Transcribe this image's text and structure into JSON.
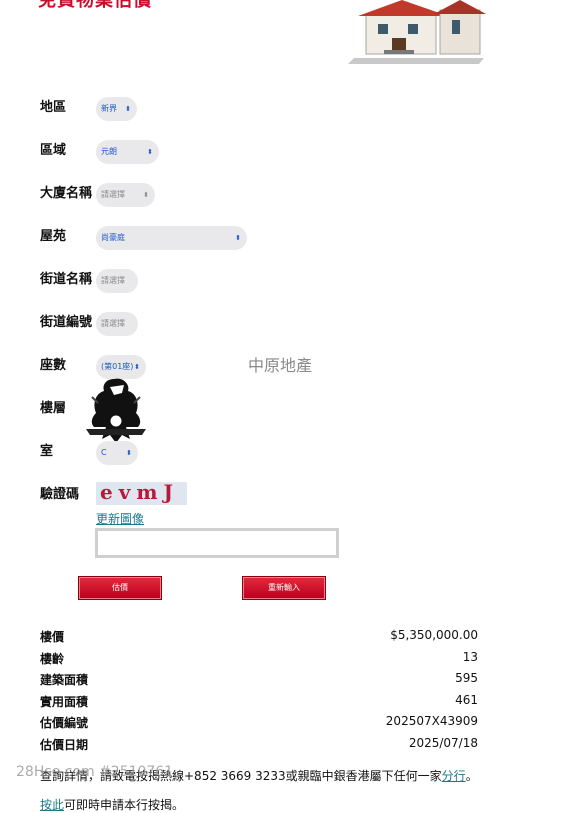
{
  "page": {
    "title": "免費物業估價"
  },
  "form": {
    "district": {
      "label": "地區",
      "value": "新界"
    },
    "area": {
      "label": "區域",
      "value": "元朗"
    },
    "building": {
      "label": "大廈名稱",
      "value": "請選擇"
    },
    "estate": {
      "label": "屋苑",
      "value": "尚豪庭"
    },
    "street_name": {
      "label": "街道名稱",
      "value": "請選擇"
    },
    "street_no": {
      "label": "街道編號",
      "value": "請選擇"
    },
    "block": {
      "label": "座數",
      "value": "(第01座)"
    },
    "floor": {
      "label": "樓層"
    },
    "flat": {
      "label": "室",
      "value": "C"
    },
    "captcha": {
      "label": "驗證碼",
      "code": "evmJ",
      "refresh_label": "更新圖像",
      "input_value": ""
    }
  },
  "watermark": {
    "agency": "中原地產",
    "site": "28Hse.com #2510761"
  },
  "buttons": {
    "estimate": "估價",
    "reset": "重新輸入"
  },
  "result": [
    {
      "label": "樓價",
      "value": "$5,350,000.00"
    },
    {
      "label": "樓齡",
      "value": "13"
    },
    {
      "label": "建築面積",
      "value": "595"
    },
    {
      "label": "實用面積",
      "value": "461"
    },
    {
      "label": "估價編號",
      "value": "202507X43909"
    },
    {
      "label": "估價日期",
      "value": "2025/07/18"
    }
  ],
  "footer": {
    "text": "查詢詳情，請致電按揭熱線+852 3669 3233或親臨中銀香港屬下任何一家",
    "link": "分行",
    "end": "。",
    "line2_link": "按此",
    "line2_text": "可即時申請本行按揭。"
  },
  "icons": {
    "chevron": "chevron-updown-icon",
    "house": "house-illustration",
    "eagle": "eagle-logo"
  }
}
